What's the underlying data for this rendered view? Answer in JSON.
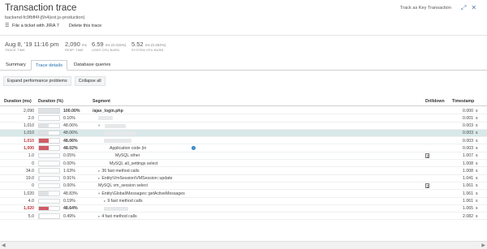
{
  "header": {
    "title": "Transaction trace",
    "subtitle": "backend-fc9fbff4f-j5h4(ext.js-production)",
    "file_ticket": "File a ticket with JIRA 7",
    "delete": "Delete this trace",
    "key_transaction": "Track as Key Transaction",
    "expand_icon": "expand-icon",
    "close_icon": "close-icon"
  },
  "metrics": [
    {
      "value": "Aug 8, '19 11:16 pm",
      "unit": "",
      "label": "TRACE TIME"
    },
    {
      "value": "2,090",
      "unit": "ms",
      "label": "RESP. TIME"
    },
    {
      "value": "6.59",
      "unit": "ms (0.315%)",
      "label": "USER CPU BURN"
    },
    {
      "value": "5.52",
      "unit": "ms (0.264%)",
      "label": "SYSTEM CPU BURN"
    }
  ],
  "tabs": [
    "Summary",
    "Trace details",
    "Database queries"
  ],
  "active_tab": "Trace details",
  "toolbar": {
    "expand": "Expand performance problems",
    "collapse": "Collapse all"
  },
  "columns": {
    "duration_ms": "Duration (ms)",
    "duration_pct": "Duration (%)",
    "segment": "Segment",
    "drilldown": "Drilldown",
    "timestamp": "Timestamp"
  },
  "rows": [
    {
      "dur": "2,090",
      "pct": "100.00%",
      "pct_value": 1.0,
      "seg": "/ajax_login.php",
      "indent": 0,
      "twisty": "",
      "red": false,
      "bold_seg": true,
      "ts": "0.000",
      "unit": "s",
      "dd": false
    },
    {
      "dur": "2.0",
      "pct": "0.10%",
      "pct_value": 0.001,
      "seg": "",
      "indent": 1,
      "twisty": "",
      "red": false,
      "ts": "0.001",
      "unit": "s",
      "dd": false
    },
    {
      "dur": "1,010",
      "pct": "48.06%",
      "pct_value": 0.4806,
      "seg": "",
      "indent": 1,
      "twisty": "▾",
      "red": false,
      "ts": "0.003",
      "unit": "s",
      "dd": false
    },
    {
      "dur": "1,010",
      "pct": "48.06%",
      "pct_value": 0.4806,
      "seg": "",
      "indent": 2,
      "twisty": "",
      "red": false,
      "sel": true,
      "ts": "0.003",
      "unit": "s",
      "dd": false
    },
    {
      "dur": "1,010",
      "pct": "48.06%",
      "pct_value": 0.4806,
      "seg": "",
      "indent": 2,
      "twisty": "",
      "red": true,
      "ts": "0.003",
      "unit": "s",
      "dd": false
    },
    {
      "dur": "1,000",
      "pct": "48.02%",
      "pct_value": 0.4802,
      "seg": "Application code (in",
      "indent": 3,
      "twisty": "",
      "red": true,
      "info": true,
      "ts": "0.003",
      "unit": "s",
      "dd": false
    },
    {
      "dur": "1.0",
      "pct": "0.05%",
      "pct_value": 0.0005,
      "seg": "MySQL other",
      "indent": 4,
      "twisty": "",
      "red": false,
      "ts": "1.007",
      "unit": "s",
      "dd": true
    },
    {
      "dur": "0",
      "pct": "0.00%",
      "pct_value": 0.0,
      "seg": "MySQL all_settings select",
      "indent": 3,
      "twisty": "",
      "red": false,
      "ts": "1.008",
      "unit": "s",
      "dd": false
    },
    {
      "dur": "34.0",
      "pct": "1.63%",
      "pct_value": 0.0163,
      "seg": "36 fast method calls",
      "indent": 1,
      "twisty": "▸",
      "red": false,
      "ts": "1.008",
      "unit": "s",
      "dd": false
    },
    {
      "dur": "19.0",
      "pct": "0.91%",
      "pct_value": 0.0091,
      "seg": "Entity\\VmSession\\VMSession::update",
      "indent": 1,
      "twisty": "▸",
      "red": false,
      "ts": "1.041",
      "unit": "s",
      "dd": false
    },
    {
      "dur": "0",
      "pct": "0.00%",
      "pct_value": 0.0,
      "seg": "MySQL vm_session select",
      "indent": 1,
      "twisty": "",
      "red": false,
      "ts": "1.061",
      "unit": "s",
      "dd": true
    },
    {
      "dur": "1,020",
      "pct": "48.83%",
      "pct_value": 0.4883,
      "seg": "Entity\\Global\\Messages::getActiveMessages",
      "indent": 1,
      "twisty": "▾",
      "red": false,
      "ts": "1.061",
      "unit": "s",
      "dd": false
    },
    {
      "dur": "4.0",
      "pct": "0.19%",
      "pct_value": 0.0019,
      "seg": "9 fast method calls",
      "indent": 2,
      "twisty": "▸",
      "red": false,
      "ts": "1.061",
      "unit": "s",
      "dd": false
    },
    {
      "dur": "1,020",
      "pct": "48.64%",
      "pct_value": 0.4864,
      "seg": "",
      "indent": 2,
      "twisty": "",
      "red": true,
      "ts": "1.065",
      "unit": "s",
      "dd": false
    },
    {
      "dur": "5.0",
      "pct": "0.49%",
      "pct_value": 0.0049,
      "seg": "4 fast method calls",
      "indent": 1,
      "twisty": "▸",
      "red": false,
      "ts": "2.082",
      "unit": "s",
      "dd": false
    }
  ]
}
